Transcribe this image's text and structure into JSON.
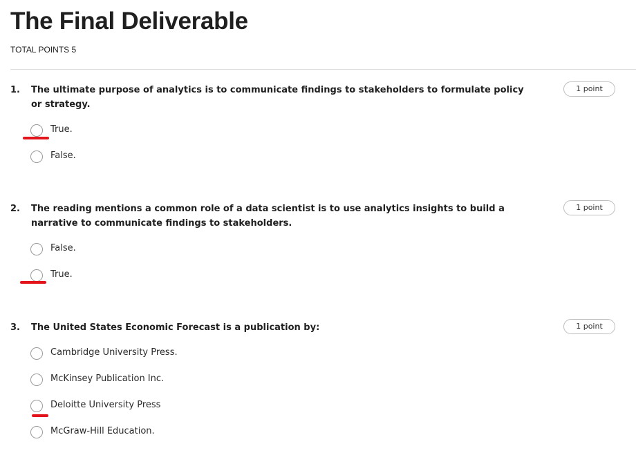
{
  "header": {
    "title": "The Final Deliverable",
    "total_points": "TOTAL POINTS 5"
  },
  "questions": [
    {
      "number": "1.",
      "text": "The ultimate purpose of analytics is to communicate findings to stakeholders to formulate policy or strategy.",
      "points": "1 point",
      "options": [
        "True.",
        "False."
      ],
      "marked_option": "True."
    },
    {
      "number": "2.",
      "text": "The reading mentions a common role of a data scientist is to use analytics insights to build a narrative to communicate findings to stakeholders.",
      "points": "1 point",
      "options": [
        "False.",
        "True."
      ],
      "marked_option": "True."
    },
    {
      "number": "3.",
      "text": "The United States Economic Forecast is a publication by:",
      "points": "1 point",
      "options": [
        "Cambridge University Press.",
        "McKinsey Publication Inc.",
        "Deloitte University Press",
        "McGraw-Hill Education."
      ],
      "marked_option": "Deloitte University Press"
    }
  ],
  "colors": {
    "annotation_mark": "#e3141b",
    "radio_border": "#9a9a9a"
  }
}
